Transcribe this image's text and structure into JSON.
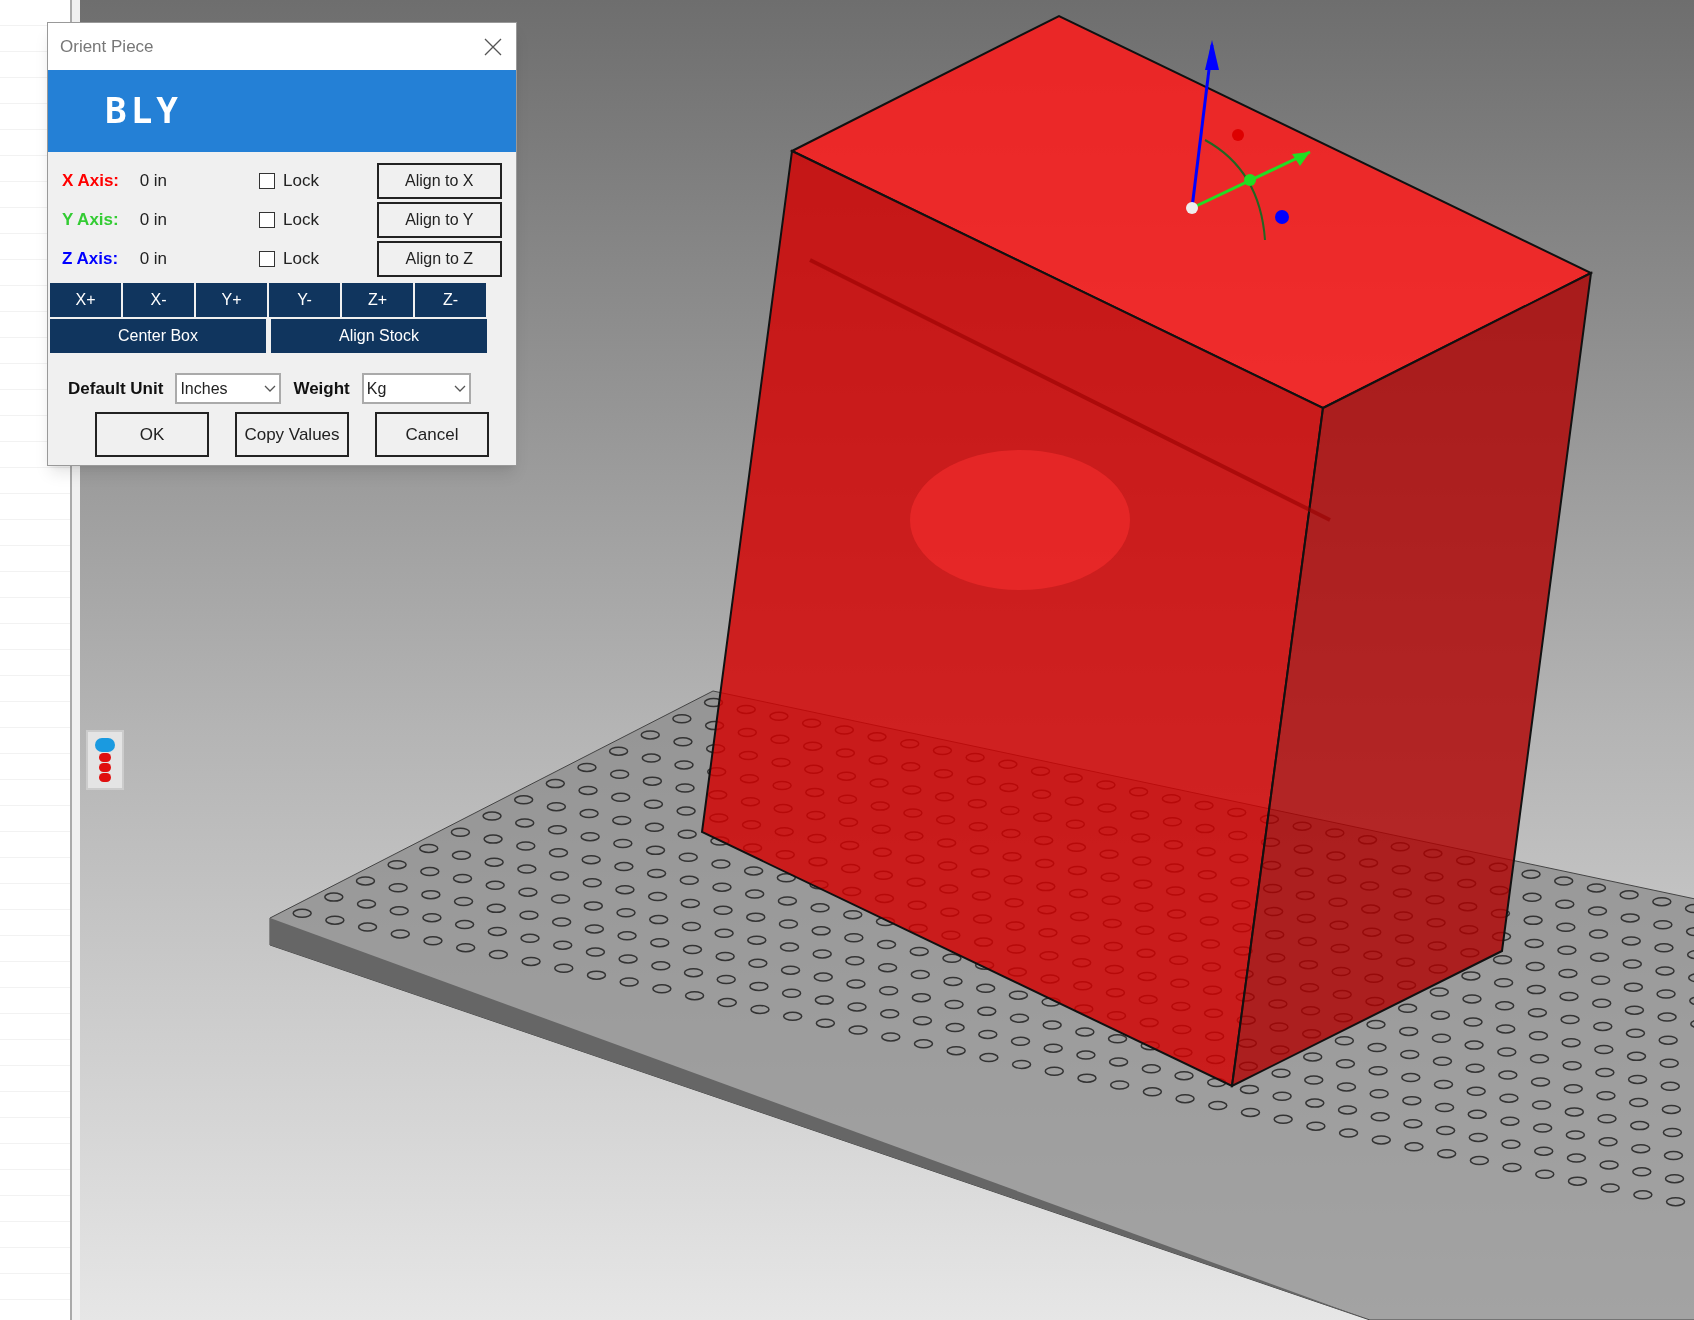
{
  "dialog": {
    "title": "Orient Piece",
    "logo": "BLY",
    "axes": [
      {
        "label": "X Axis:",
        "color": "#ff0000",
        "value": "0 in",
        "lock": {
          "label": "Lock",
          "checked": false
        },
        "align_button": "Align to X"
      },
      {
        "label": "Y Axis:",
        "color": "#33cc33",
        "value": "0 in",
        "lock": {
          "label": "Lock",
          "checked": false
        },
        "align_button": "Align to Y"
      },
      {
        "label": "Z Axis:",
        "color": "#0000ff",
        "value": "0 in",
        "lock": {
          "label": "Lock",
          "checked": false
        },
        "align_button": "Align to Z"
      }
    ],
    "direction_buttons": [
      "X+",
      "X-",
      "Y+",
      "Y-",
      "Z+",
      "Z-"
    ],
    "action_buttons": [
      "Center Box",
      "Align Stock"
    ],
    "default_unit": {
      "label": "Default Unit",
      "value": "Inches"
    },
    "weight": {
      "label": "Weight",
      "value": "Kg"
    },
    "buttons": [
      "OK",
      "Copy Values",
      "Cancel"
    ]
  }
}
